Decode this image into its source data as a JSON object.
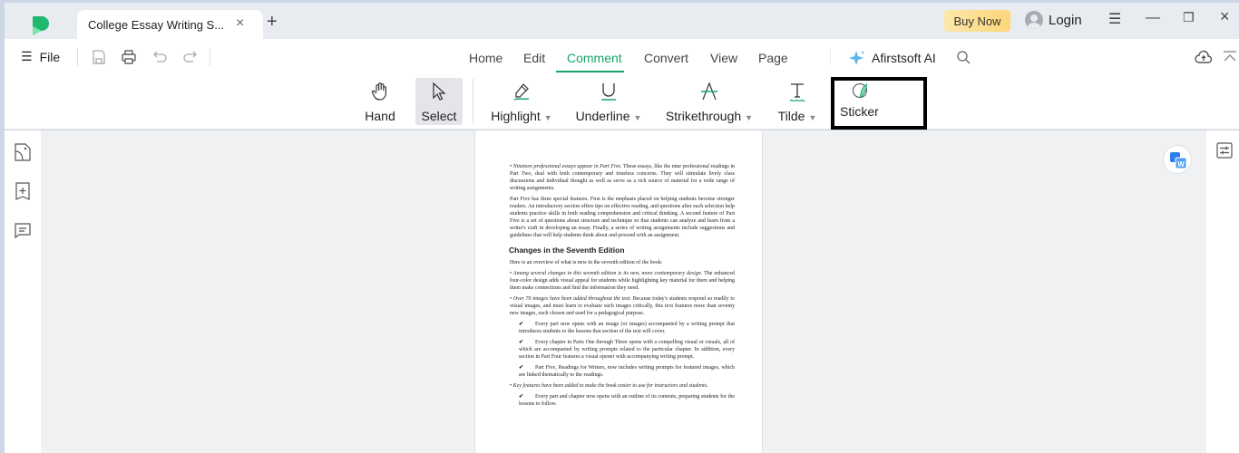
{
  "titlebar": {
    "tab_title": "College Essay Writing S...",
    "tab_close": "×",
    "new_tab": "+",
    "buy_now": "Buy Now",
    "login": "Login",
    "menu": "☰",
    "minimize": "—",
    "restore": "❐",
    "close": "×"
  },
  "menubar": {
    "file": "File",
    "file_icon": "☰",
    "tabs": [
      {
        "label": "Home"
      },
      {
        "label": "Edit"
      },
      {
        "label": "Comment",
        "active": true
      },
      {
        "label": "Convert"
      },
      {
        "label": "View"
      },
      {
        "label": "Page"
      }
    ],
    "ai_label": "Afirstsoft AI",
    "accent_color": "#17a56b"
  },
  "ribbon": {
    "tools": [
      {
        "label": "Hand"
      },
      {
        "label": "Select",
        "selected": true
      },
      {
        "label": "Highlight",
        "dropdown": true
      },
      {
        "label": "Underline",
        "dropdown": true
      },
      {
        "label": "Strikethrough",
        "dropdown": true
      },
      {
        "label": "Tilde",
        "dropdown": true
      },
      {
        "label": "Sticker"
      }
    ],
    "caret": "▼"
  },
  "document": {
    "p1_italic": "• Nineteen professional essays appear in Part Five.",
    "p1_rest": " These essays, like the nine professional readings in Part Two, deal with both contemporary and timeless concerns. They will stimulate lively class discussions and individual thought as well as serve as a rich source of material for a wide range of writing assignments.",
    "p2": "Part Five has three special features. First is the emphasis placed on helping students become stronger readers. An introductory section offers tips on effective reading, and questions after each selection help students practice skills in both reading comprehension and critical thinking. A second feature of Part Five is a set of questions about structure and technique so that students can analyze and learn from a writer's craft in developing an essay. Finally, a series of writing assignments include suggestions and guidelines that will help students think about and proceed with an assignment.",
    "heading": "Changes in the Seventh Edition",
    "intro": "Here is an overview of what is new in the seventh edition of the book:",
    "b1_italic": "• Among several changes in this seventh edition is its new, more contemporary design.",
    "b1_rest": " The enhanced four-color design adds visual appeal for students while highlighting key material for them and helping them make connections and find the information they need.",
    "b2_italic": "• Over 70 images have been added throughout the text.",
    "b2_rest": " Because today's students respond so readily to visual images, and must learn to evaluate such images critically, this text features more than seventy new images, each chosen and used for a pedagogical purpose.",
    "check": "✔",
    "c1": "Every part now opens with an image (or images) accompanied by a writing prompt that introduces students to the lessons that section of the text will cover.",
    "c2": "Every chapter in Parts One through Three opens with a compelling visual or visuals, all of which are accompanied by writing prompts related to the particular chapter. In addition, every section in Part Four features a visual opener with accompanying writing prompt.",
    "c3": "Part Five, Readings for Writers, now includes writing prompts for featured images, which are linked thematically to the readings.",
    "b3_italic": "• Key features have been added to make the book easier to use for instructors and students.",
    "c4": "Every part and chapter now opens with an outline of its contents, preparing students for the lessons to follow."
  }
}
